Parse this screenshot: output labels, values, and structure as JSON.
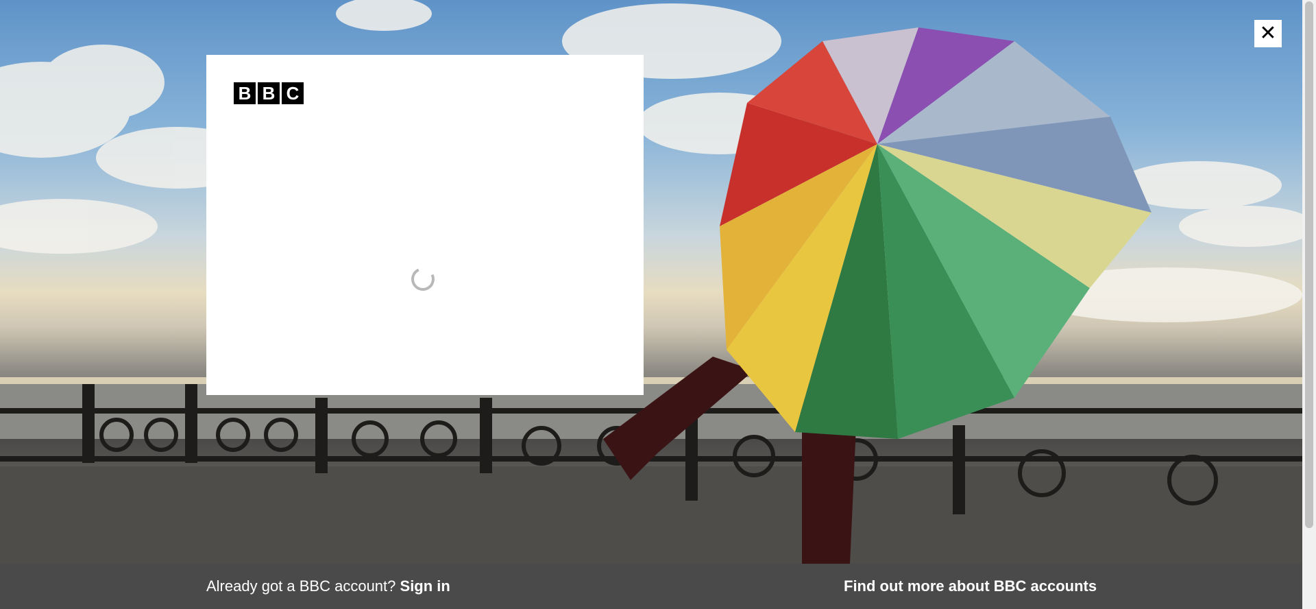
{
  "close_icon": "close-icon",
  "logo": {
    "letters": [
      "B",
      "B",
      "C"
    ]
  },
  "loading": {
    "icon": "loading-spinner-icon"
  },
  "footer": {
    "signin_prompt": "Already got a BBC account?",
    "signin_link": "Sign in",
    "find_out_link": "Find out more about BBC accounts"
  },
  "colors": {
    "footer_bg": "#4a4a4a",
    "modal_bg": "#ffffff",
    "logo_block": "#000000"
  }
}
